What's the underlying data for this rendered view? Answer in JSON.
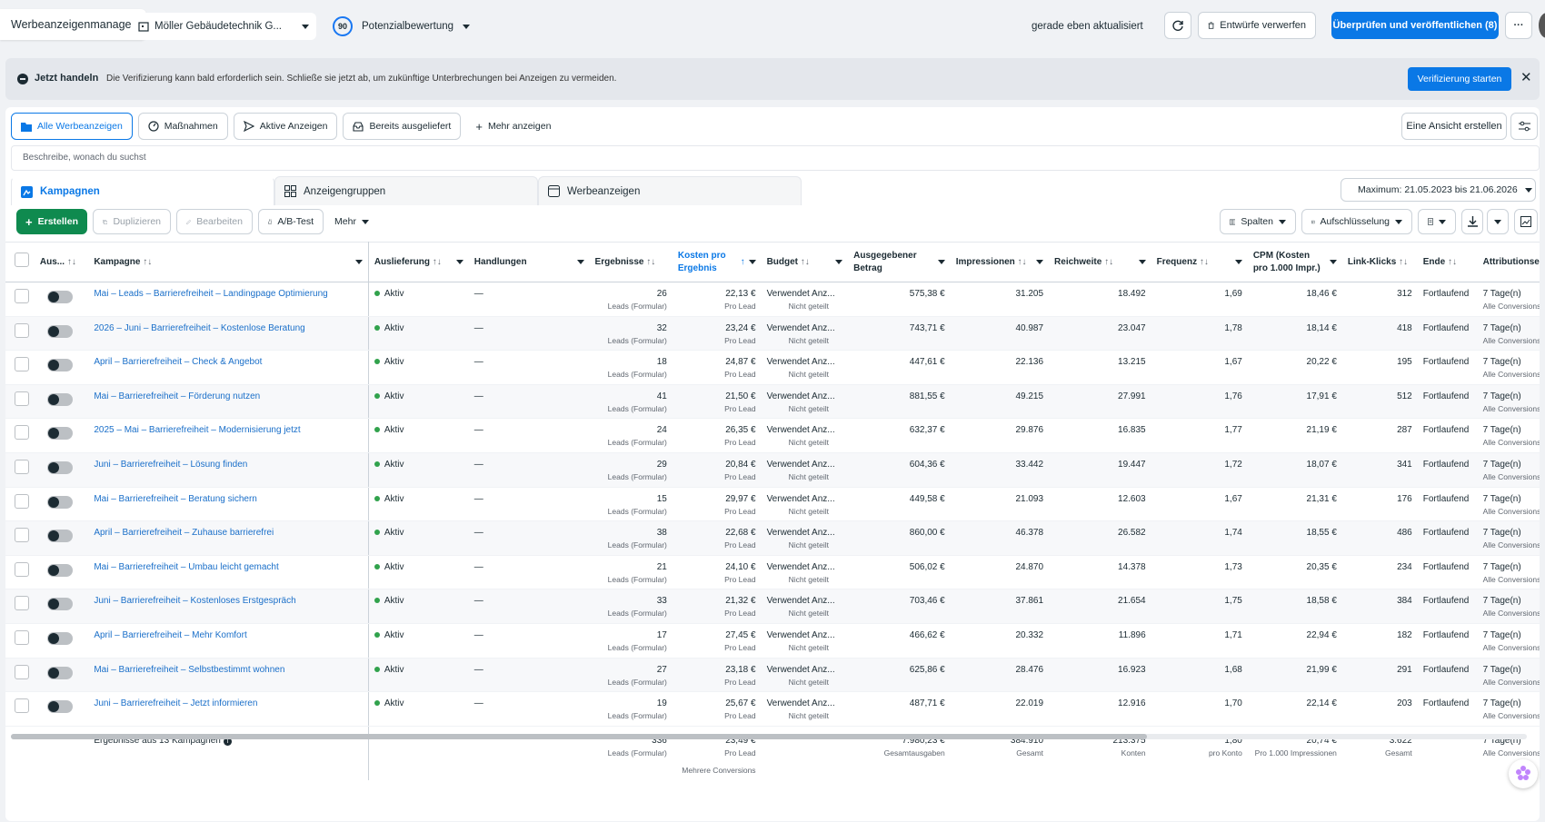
{
  "header": {
    "app_title": "Werbeanzeigenmanager",
    "account": "Möller Gebäudetechnik G...",
    "score": "90",
    "score_label": "Potenzialbewertung",
    "updated": "gerade eben aktualisiert",
    "discard": "Entwürfe verwerfen",
    "publish": "Überprüfen und veröffentlichen (8)",
    "more": "···"
  },
  "banner": {
    "strong": "Jetzt handeln",
    "text": "Die Verifizierung kann bald erforderlich sein. Schließe sie jetzt ab, um zukünftige Unterbrechungen bei Anzeigen zu vermeiden.",
    "button": "Verifizierung starten"
  },
  "view_tabs": [
    "Alle Werbeanzeigen",
    "Maßnahmen",
    "Aktive Anzeigen",
    "Bereits ausgeliefert",
    "Mehr anzeigen"
  ],
  "create_view": "Eine Ansicht erstellen",
  "search_placeholder": "Beschreibe, wonach du suchst",
  "level_tabs": [
    "Kampagnen",
    "Anzeigengruppen",
    "Werbeanzeigen"
  ],
  "date_range": "Maximum: 21.05.2023 bis 21.06.2026",
  "toolbar": {
    "create": "Erstellen",
    "duplicate": "Duplizieren",
    "edit": "Bearbeiten",
    "ab_test": "A/B-Test",
    "more": "Mehr",
    "columns": "Spalten",
    "breakdown": "Aufschlüsselung"
  },
  "columns": {
    "delivery_short": "Aus...",
    "campaign": "Kampagne",
    "delivery": "Auslieferung",
    "actions": "Handlungen",
    "results": "Ergebnisse",
    "cost": "Kosten pro Ergebnis",
    "budget": "Budget",
    "spent": "Ausgegebener Betrag",
    "impressions": "Impressionen",
    "reach": "Reichweite",
    "frequency": "Frequenz",
    "cpm": "CPM (Kosten pro 1.000 Impr.)",
    "clicks": "Link-Klicks",
    "end": "Ende",
    "attribution": "Attributionsein"
  },
  "sort_icon": "↑↓",
  "sorted_icon": "↑",
  "row_common": {
    "status": "Aktiv",
    "actions": "—",
    "results_sub": "Leads (Formular)",
    "cost_sub": "Pro Lead",
    "budget": "Verwendet Anz...",
    "budget_sub": "Nicht geteilt",
    "end": "Fortlaufend",
    "attribution": "7 Tage(n)",
    "attribution_sub": "Alle Conversions"
  },
  "rows": [
    {
      "name": "Mai – Leads – Barrierefreiheit – Landingpage Optimierung",
      "results": "26",
      "cost": "22,13 €",
      "spent": "575,38 €",
      "impressions": "31.205",
      "reach": "18.492",
      "frequency": "1,69",
      "cpm": "18,46 €",
      "clicks": "312"
    },
    {
      "name": "2026 – Juni – Barrierefreiheit – Kostenlose Beratung",
      "results": "32",
      "cost": "23,24 €",
      "spent": "743,71 €",
      "impressions": "40.987",
      "reach": "23.047",
      "frequency": "1,78",
      "cpm": "18,14 €",
      "clicks": "418"
    },
    {
      "name": "April – Barrierefreiheit – Check & Angebot",
      "results": "18",
      "cost": "24,87 €",
      "spent": "447,61 €",
      "impressions": "22.136",
      "reach": "13.215",
      "frequency": "1,67",
      "cpm": "20,22 €",
      "clicks": "195"
    },
    {
      "name": "Mai – Barrierefreiheit – Förderung nutzen",
      "results": "41",
      "cost": "21,50 €",
      "spent": "881,55 €",
      "impressions": "49.215",
      "reach": "27.991",
      "frequency": "1,76",
      "cpm": "17,91 €",
      "clicks": "512"
    },
    {
      "name": "2025 – Mai – Barrierefreiheit – Modernisierung jetzt",
      "results": "24",
      "cost": "26,35 €",
      "spent": "632,37 €",
      "impressions": "29.876",
      "reach": "16.835",
      "frequency": "1,77",
      "cpm": "21,19 €",
      "clicks": "287"
    },
    {
      "name": "Juni – Barrierefreiheit – Lösung finden",
      "results": "29",
      "cost": "20,84 €",
      "spent": "604,36 €",
      "impressions": "33.442",
      "reach": "19.447",
      "frequency": "1,72",
      "cpm": "18,07 €",
      "clicks": "341"
    },
    {
      "name": "Mai – Barrierefreiheit – Beratung sichern",
      "results": "15",
      "cost": "29,97 €",
      "spent": "449,58 €",
      "impressions": "21.093",
      "reach": "12.603",
      "frequency": "1,67",
      "cpm": "21,31 €",
      "clicks": "176"
    },
    {
      "name": "April – Barrierefreiheit – Zuhause barrierefrei",
      "results": "38",
      "cost": "22,68 €",
      "spent": "860,00 €",
      "impressions": "46.378",
      "reach": "26.582",
      "frequency": "1,74",
      "cpm": "18,55 €",
      "clicks": "486"
    },
    {
      "name": "Mai – Barrierefreiheit – Umbau leicht gemacht",
      "results": "21",
      "cost": "24,10 €",
      "spent": "506,02 €",
      "impressions": "24.870",
      "reach": "14.378",
      "frequency": "1,73",
      "cpm": "20,35 €",
      "clicks": "234"
    },
    {
      "name": "Juni – Barrierefreiheit – Kostenloses Erstgespräch",
      "results": "33",
      "cost": "21,32 €",
      "spent": "703,46 €",
      "impressions": "37.861",
      "reach": "21.654",
      "frequency": "1,75",
      "cpm": "18,58 €",
      "clicks": "384"
    },
    {
      "name": "April – Barrierefreiheit – Mehr Komfort",
      "results": "17",
      "cost": "27,45 €",
      "spent": "466,62 €",
      "impressions": "20.332",
      "reach": "11.896",
      "frequency": "1,71",
      "cpm": "22,94 €",
      "clicks": "182"
    },
    {
      "name": "Mai – Barrierefreiheit – Selbstbestimmt wohnen",
      "results": "27",
      "cost": "23,18 €",
      "spent": "625,86 €",
      "impressions": "28.476",
      "reach": "16.923",
      "frequency": "1,68",
      "cpm": "21,99 €",
      "clicks": "291"
    },
    {
      "name": "Juni – Barrierefreiheit – Jetzt informieren",
      "results": "19",
      "cost": "25,67 €",
      "spent": "487,71 €",
      "impressions": "22.019",
      "reach": "12.916",
      "frequency": "1,70",
      "cpm": "22,14 €",
      "clicks": "203"
    }
  ],
  "totals": {
    "label": "Ergebnisse aus 13 Kampagnen",
    "results": "336",
    "results_sub": "Leads (Formular)",
    "cost": "23,49 €",
    "cost_sub": "Pro Lead",
    "cost_sub2": "Mehrere Conversions",
    "spent": "7.980,23 €",
    "spent_sub": "Gesamtausgaben",
    "impressions": "384.910",
    "impressions_sub": "Gesamt",
    "reach": "213.375",
    "reach_sub": "Konten",
    "frequency": "1,80",
    "frequency_sub": "pro Konto",
    "cpm": "20,74 €",
    "cpm_sub": "Pro 1.000 Impressionen",
    "clicks": "3.622",
    "clicks_sub": "Gesamt",
    "attribution": "7 Tage(n)",
    "attribution_sub": "Alle Conversions"
  },
  "colors": {
    "primary": "#0a78e6",
    "create": "#0f8a4f",
    "active": "#31a24c",
    "link": "#1a6fc9"
  }
}
